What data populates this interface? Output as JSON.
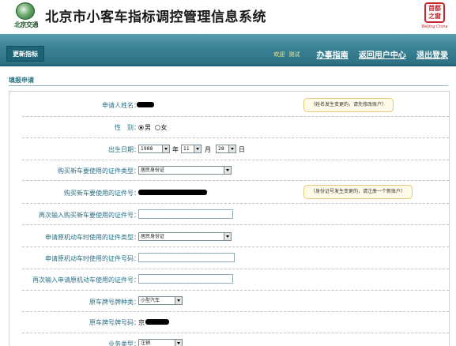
{
  "header": {
    "logo_text": "北京交通",
    "title": "北京市小客车指标调控管理信息系统",
    "emblem_text": "首都之窗",
    "emblem_sub": "Beijing China"
  },
  "nav": {
    "active_tab": "更新指标",
    "welcome": "欢迎",
    "username": "测试",
    "links": [
      "办事指南",
      "返回用户中心",
      "退出登录"
    ]
  },
  "section": {
    "title": "填报申请"
  },
  "form": {
    "applicant_name": {
      "label": "申请人姓名：",
      "note": "（姓名发生变更的，请先修改账户）"
    },
    "gender": {
      "label": "性　别：",
      "options": [
        "男",
        "女"
      ],
      "selected": "男"
    },
    "birth": {
      "label": "出生日期：",
      "year": "1988",
      "month": "11",
      "day": "28",
      "year_unit": "年",
      "month_unit": "月",
      "day_unit": "日"
    },
    "new_id_type": {
      "label": "购买新车要使用的证件类型：",
      "value": "居民身份证"
    },
    "new_id_number": {
      "label": "购买新车要使用的证件号：",
      "note": "（身份证号发生变更的，请注册一个新账户）"
    },
    "new_id_confirm": {
      "label": "再次输入购买新车要使用的证件号：",
      "value": ""
    },
    "old_id_type": {
      "label": "申请原机动车时使用的证件类型：",
      "value": "居民身份证"
    },
    "old_id_number": {
      "label": "申请原机动车时使用的证件号码：",
      "value": ""
    },
    "old_id_confirm": {
      "label": "再次输入申请原机动车使用的证件号：",
      "value": ""
    },
    "plate_type": {
      "label": "原车牌号牌种类：",
      "value": "小型汽车"
    },
    "plate_number": {
      "label": "原车牌号牌号码：",
      "prefix": "京"
    },
    "business_type": {
      "label": "业务类型：",
      "value": "注销"
    }
  },
  "colors": {
    "nav_bar": "#3d8598",
    "label": "#2b6f83",
    "note_border": "#e8c77a"
  }
}
